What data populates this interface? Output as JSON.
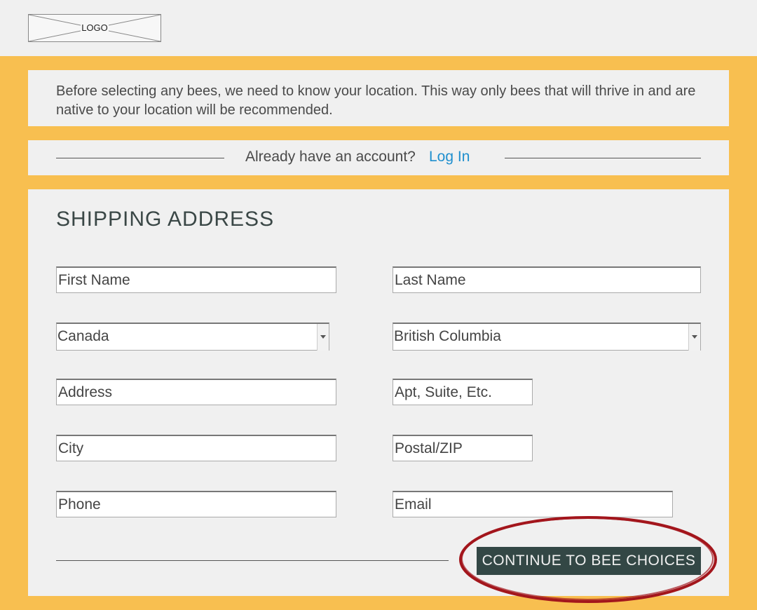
{
  "header": {
    "logo_text": "LOGO"
  },
  "intro": {
    "text": "Before selecting any bees, we need to know your location. This way only bees that will thrive in and are native to your location will be recommended."
  },
  "account": {
    "question": "Already have an account?",
    "login_label": "Log In"
  },
  "form": {
    "title": "SHIPPING ADDRESS",
    "first_name": {
      "placeholder": "First Name"
    },
    "last_name": {
      "placeholder": "Last Name"
    },
    "country": {
      "value": "Canada"
    },
    "province": {
      "value": "British Columbia"
    },
    "address": {
      "placeholder": "Address"
    },
    "apt": {
      "placeholder": "Apt, Suite, Etc."
    },
    "city": {
      "placeholder": "City"
    },
    "postal": {
      "placeholder": "Postal/ZIP"
    },
    "phone": {
      "placeholder": "Phone"
    },
    "email": {
      "placeholder": "Email"
    },
    "continue_label": "CONTINUE TO BEE CHOICES"
  },
  "colors": {
    "accent_background": "#f8bf50",
    "panel_background": "#f0f0f0",
    "button_background": "#334745",
    "link": "#1f8fce",
    "highlight_ring": "#a3161c"
  }
}
